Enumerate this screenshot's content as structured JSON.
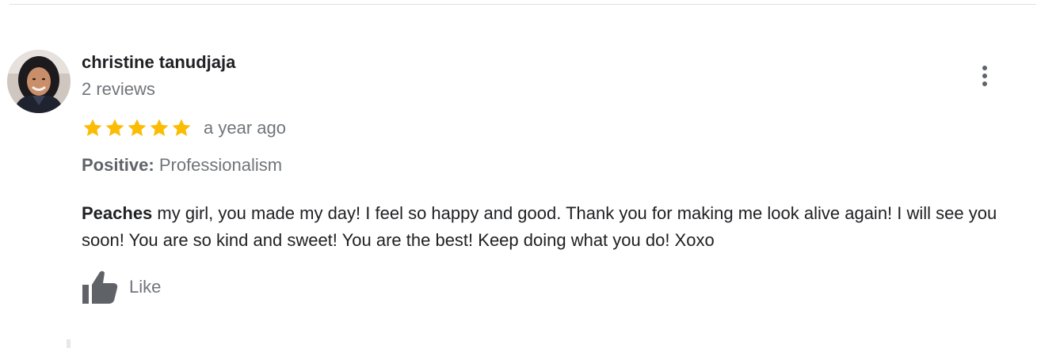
{
  "review": {
    "reviewer_name": "christine tanudjaja",
    "review_count": "2 reviews",
    "rating": 5,
    "rating_max": 5,
    "star_color": "#fbbc04",
    "time_ago": "a year ago",
    "attribute_label": "Positive:",
    "attribute_value": "Professionalism",
    "text_highlight": "Peaches",
    "text_body": " my girl, you made my day! I feel so happy and good. Thank you for making me look alive again! I will see you soon! You are so kind and sweet! You are the best! Keep doing what you do! Xoxo",
    "like_label": "Like",
    "icons": {
      "more": "more-vert-icon",
      "like": "thumbs-up-icon",
      "star": "star-icon"
    }
  }
}
